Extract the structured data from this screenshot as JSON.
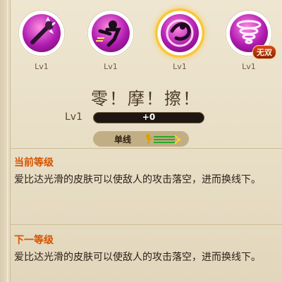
{
  "skills": [
    {
      "level": "Lv1",
      "icon": "spiked-club-icon"
    },
    {
      "level": "Lv1",
      "icon": "kick-icon"
    },
    {
      "level": "Lv1",
      "icon": "spin-strike-icon",
      "selected": true
    },
    {
      "level": "Lv1",
      "icon": "tornado-icon",
      "badge": "无双"
    }
  ],
  "skill": {
    "name": "零！摩！擦！",
    "level_label": "Lv1",
    "progress_text": "+0",
    "progress_fraction": 0
  },
  "tag": {
    "label": "单线",
    "icon": "single-line-icon"
  },
  "current_level": {
    "title": "当前等级",
    "description": "爱比达光滑的皮肤可以使敌人的攻击落空，进而换线下。"
  },
  "next_level": {
    "title": "下一等级",
    "description": "爱比达光滑的皮肤可以使敌人的攻击落空，进而换线下。"
  },
  "colors": {
    "background": "#e6dcc4",
    "accent_orange": "#d65300",
    "selected_ring": "#f8c63a",
    "icon_magenta": "#b11bb1"
  }
}
